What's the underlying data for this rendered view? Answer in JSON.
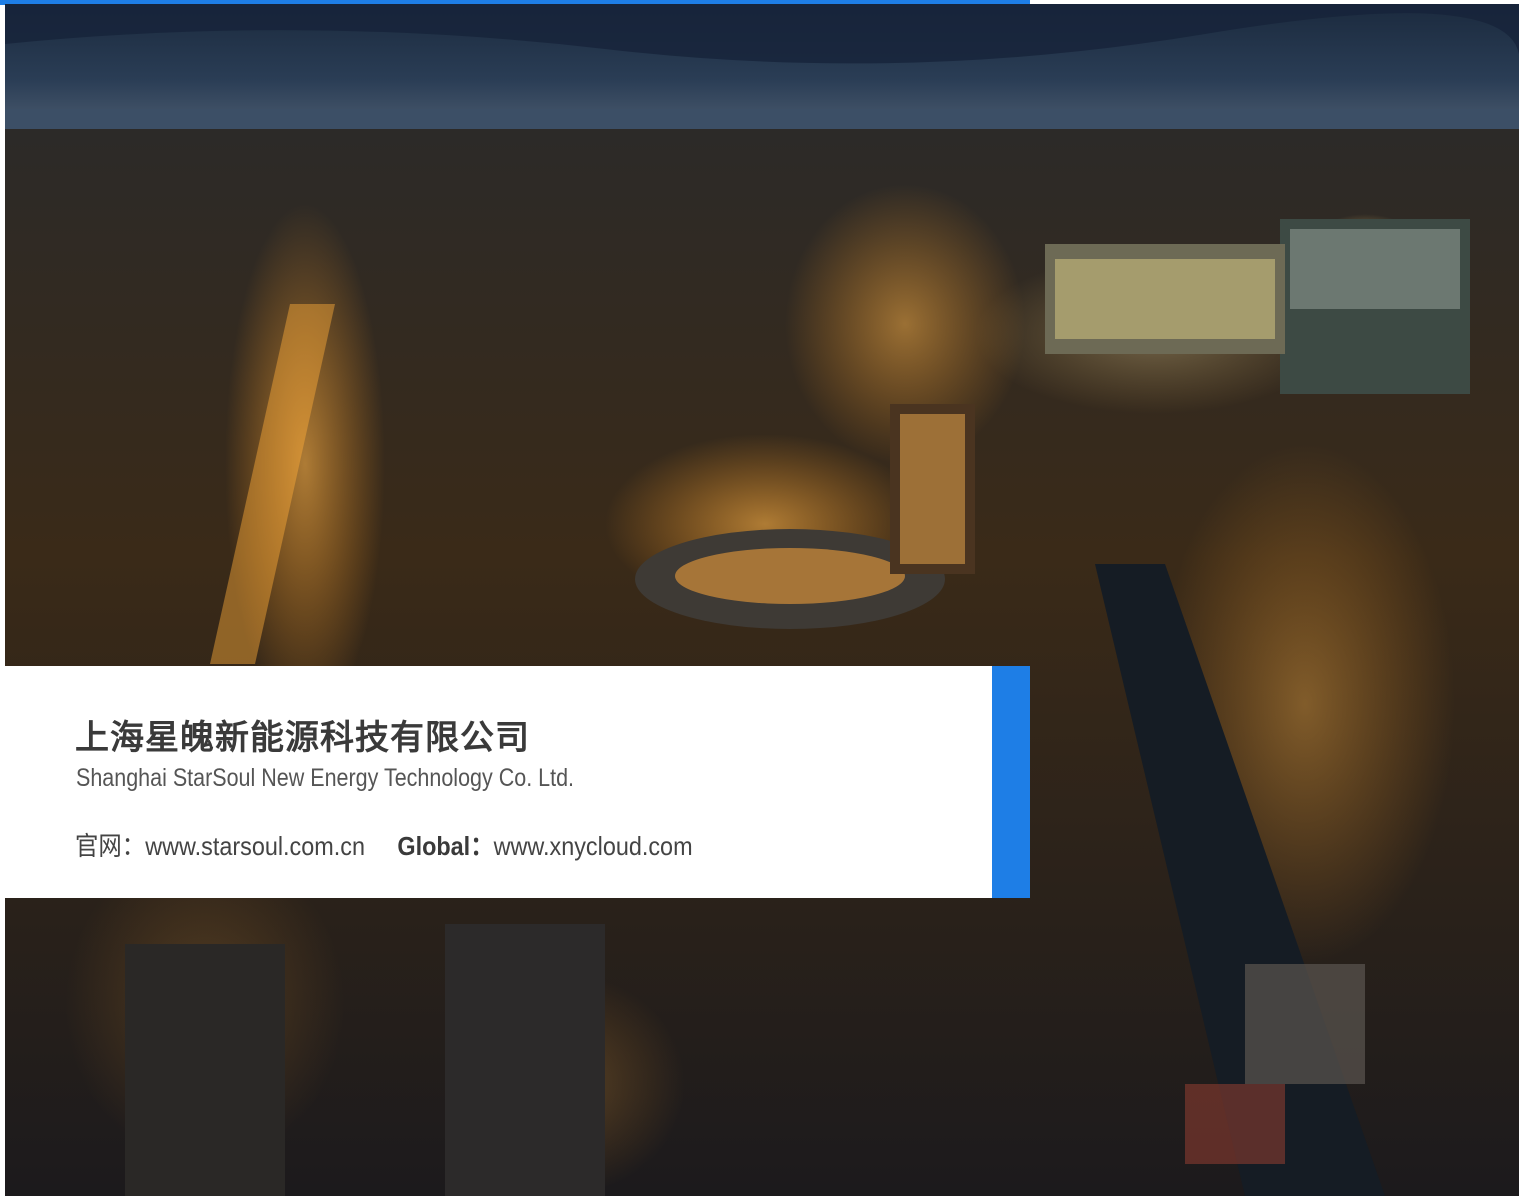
{
  "company": {
    "name_cn": "上海星魄新能源科技有限公司",
    "name_en": "Shanghai StarSoul New Energy Technology Co. Ltd."
  },
  "links": {
    "official_label": "官网：",
    "official_url": "www.starsoul.com.cn",
    "global_label": "Global：",
    "global_url": "www.xnycloud.com"
  },
  "colors": {
    "accent": "#1e7ee6",
    "card_background": "#ffffff",
    "title_text": "#3a3a3a"
  },
  "background_photo": {
    "icon": "city-night-aerial-photo"
  }
}
